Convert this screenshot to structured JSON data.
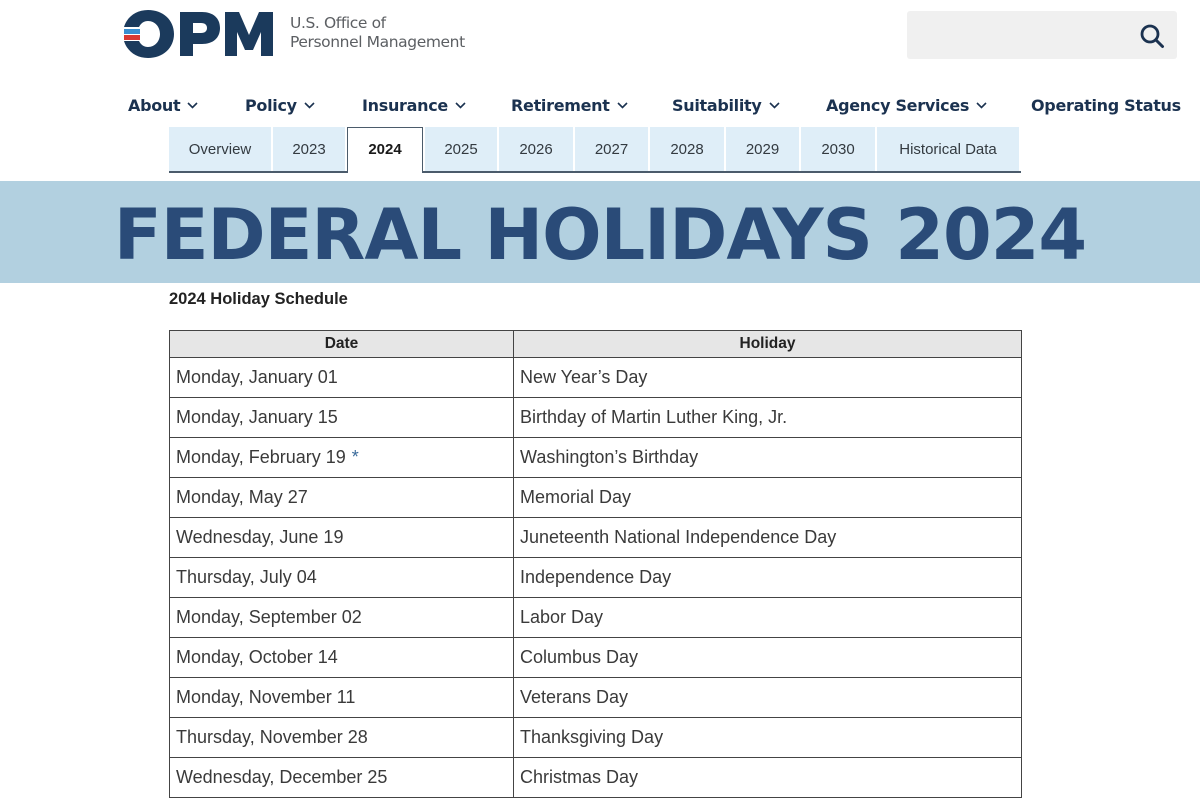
{
  "header": {
    "logo_text": "OPM",
    "org_line1": "U.S. Office of",
    "org_line2": "Personnel Management",
    "search": {
      "placeholder": "",
      "value": "",
      "icon": "search-icon"
    }
  },
  "colors": {
    "brand_navy": "#1b3a5c",
    "logo_blue": "#3a8fd0",
    "logo_red": "#d83933",
    "banner_bg": "#b2d0e0",
    "banner_text": "#2a4b78",
    "tab_bg": "#dfeef8"
  },
  "nav": {
    "items": [
      {
        "label": "About",
        "has_dropdown": true
      },
      {
        "label": "Policy",
        "has_dropdown": true
      },
      {
        "label": "Insurance",
        "has_dropdown": true
      },
      {
        "label": "Retirement",
        "has_dropdown": true
      },
      {
        "label": "Suitability",
        "has_dropdown": true
      },
      {
        "label": "Agency Services",
        "has_dropdown": true
      },
      {
        "label": "Operating Status",
        "has_dropdown": false
      }
    ]
  },
  "tabs": {
    "items": [
      {
        "label": "Overview"
      },
      {
        "label": "2023"
      },
      {
        "label": "2024",
        "active": true
      },
      {
        "label": "2025"
      },
      {
        "label": "2026"
      },
      {
        "label": "2027"
      },
      {
        "label": "2028"
      },
      {
        "label": "2029"
      },
      {
        "label": "2030"
      },
      {
        "label": "Historical Data"
      }
    ]
  },
  "banner": {
    "title": "FEDERAL HOLIDAYS 2024"
  },
  "schedule": {
    "title": "2024 Holiday Schedule",
    "columns": [
      "Date",
      "Holiday"
    ],
    "rows": [
      {
        "date": "Monday, January 01",
        "holiday": "New Year’s Day"
      },
      {
        "date": "Monday, January 15",
        "holiday": "Birthday of Martin Luther King, Jr."
      },
      {
        "date": "Monday, February 19",
        "note": "*",
        "holiday": "Washington’s Birthday"
      },
      {
        "date": "Monday, May 27",
        "holiday": "Memorial Day"
      },
      {
        "date": "Wednesday, June 19",
        "holiday": "Juneteenth National Independence Day"
      },
      {
        "date": "Thursday, July 04",
        "holiday": "Independence Day"
      },
      {
        "date": "Monday, September 02",
        "holiday": "Labor Day"
      },
      {
        "date": "Monday, October 14",
        "holiday": "Columbus Day"
      },
      {
        "date": "Monday, November 11",
        "holiday": "Veterans Day"
      },
      {
        "date": "Thursday, November 28",
        "holiday": "Thanksgiving Day"
      },
      {
        "date": "Wednesday, December 25",
        "holiday": "Christmas Day"
      }
    ]
  }
}
